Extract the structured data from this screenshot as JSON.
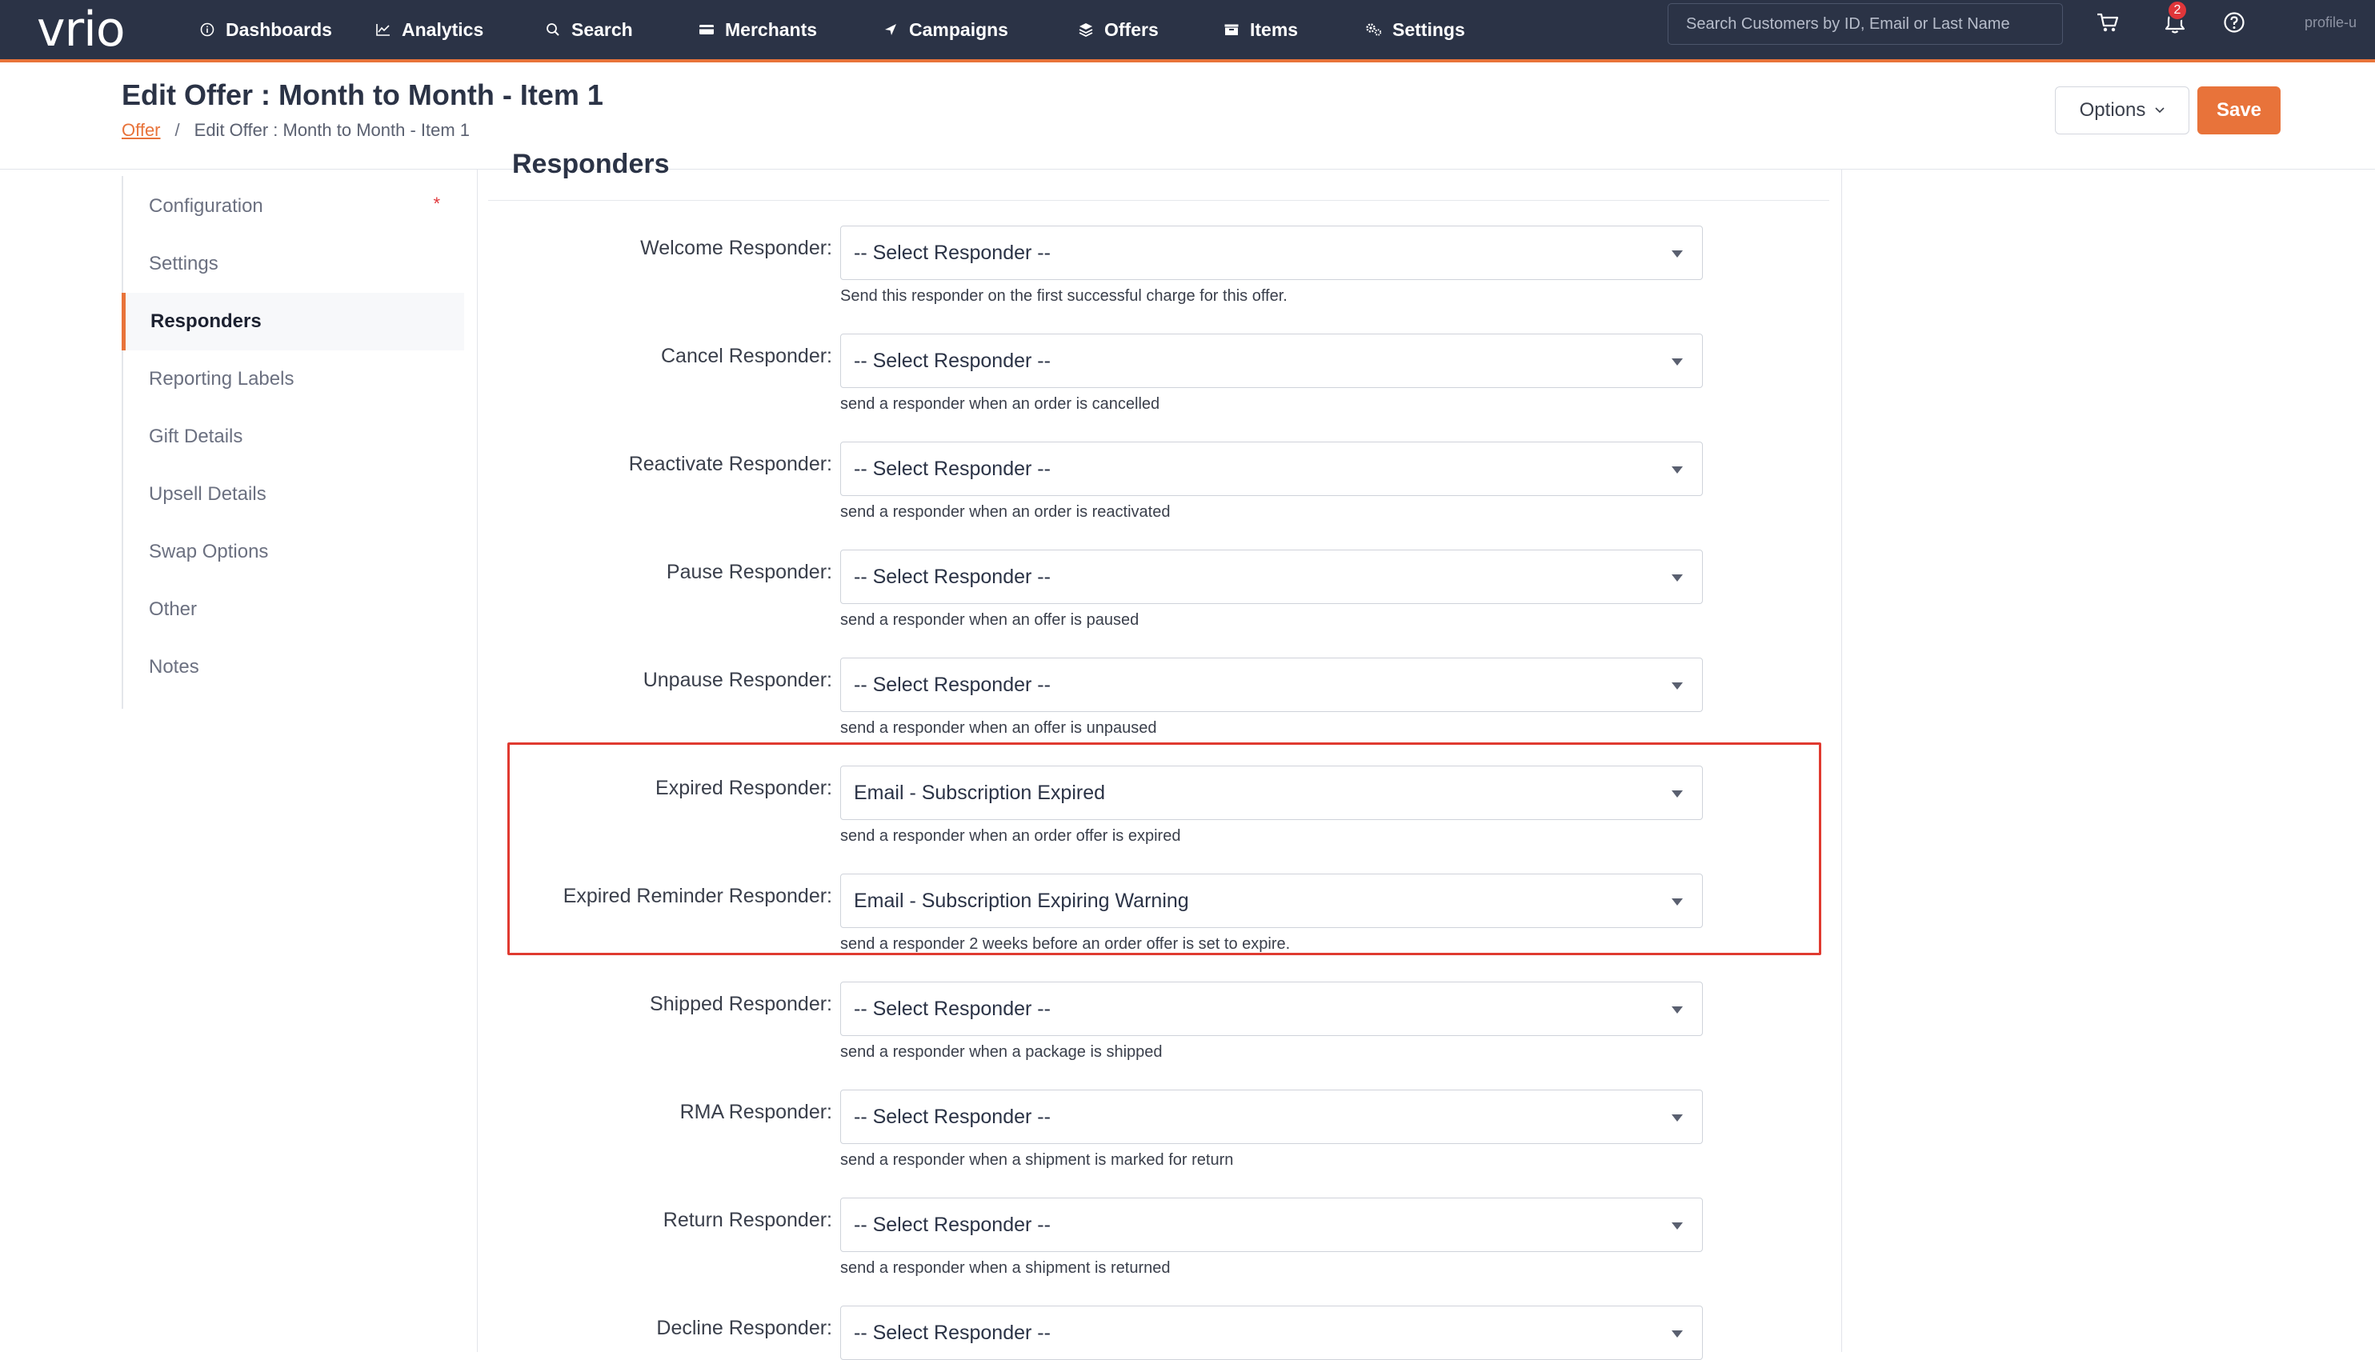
{
  "brand": {
    "logo": "vrio",
    "accent": "#e8733a",
    "nav_bg": "#2b3346"
  },
  "nav": {
    "items": [
      {
        "label": "Dashboards",
        "icon": "info-circle-icon"
      },
      {
        "label": "Analytics",
        "icon": "line-chart-icon"
      },
      {
        "label": "Search",
        "icon": "search-icon"
      },
      {
        "label": "Merchants",
        "icon": "card-icon"
      },
      {
        "label": "Campaigns",
        "icon": "send-icon"
      },
      {
        "label": "Offers",
        "icon": "layers-icon",
        "active": true
      },
      {
        "label": "Items",
        "icon": "box-icon"
      },
      {
        "label": "Settings",
        "icon": "gears-icon"
      }
    ],
    "search_placeholder": "Search Customers by ID, Email or Last Name",
    "notification_count": "2",
    "profile_alt": "profile-u"
  },
  "header": {
    "title": "Edit Offer : Month to Month - Item 1",
    "breadcrumb_link": "Offer",
    "breadcrumb_sep": "/",
    "breadcrumb_current": "Edit Offer : Month to Month - Item 1",
    "options_label": "Options",
    "save_label": "Save"
  },
  "sidebar": {
    "items": [
      {
        "label": "Configuration",
        "required": "*"
      },
      {
        "label": "Settings"
      },
      {
        "label": "Responders",
        "active": true
      },
      {
        "label": "Reporting Labels"
      },
      {
        "label": "Gift Details"
      },
      {
        "label": "Upsell Details"
      },
      {
        "label": "Swap Options"
      },
      {
        "label": "Other"
      },
      {
        "label": "Notes"
      }
    ]
  },
  "section": {
    "title": "Responders"
  },
  "responders": [
    {
      "label": "Welcome Responder:",
      "value": "-- Select Responder --",
      "hint": "Send this responder on the first successful charge for this offer."
    },
    {
      "label": "Cancel Responder:",
      "value": "-- Select Responder --",
      "hint": "send a responder when an order is cancelled"
    },
    {
      "label": "Reactivate Responder:",
      "value": "-- Select Responder --",
      "hint": "send a responder when an order is reactivated"
    },
    {
      "label": "Pause Responder:",
      "value": "-- Select Responder --",
      "hint": "send a responder when an offer is paused"
    },
    {
      "label": "Unpause Responder:",
      "value": "-- Select Responder --",
      "hint": "send a responder when an offer is unpaused"
    },
    {
      "label": "Expired Responder:",
      "value": "Email - Subscription Expired",
      "hint": "send a responder when an order offer is expired"
    },
    {
      "label": "Expired Reminder Responder:",
      "value": "Email - Subscription Expiring Warning",
      "hint": "send a responder 2 weeks before an order offer is set to expire."
    },
    {
      "label": "Shipped Responder:",
      "value": "-- Select Responder --",
      "hint": "send a responder when a package is shipped"
    },
    {
      "label": "RMA Responder:",
      "value": "-- Select Responder --",
      "hint": "send a responder when a shipment is marked for return"
    },
    {
      "label": "Return Responder:",
      "value": "-- Select Responder --",
      "hint": "send a responder when a shipment is returned"
    },
    {
      "label": "Decline Responder:",
      "value": "-- Select Responder --",
      "hint": ""
    }
  ]
}
